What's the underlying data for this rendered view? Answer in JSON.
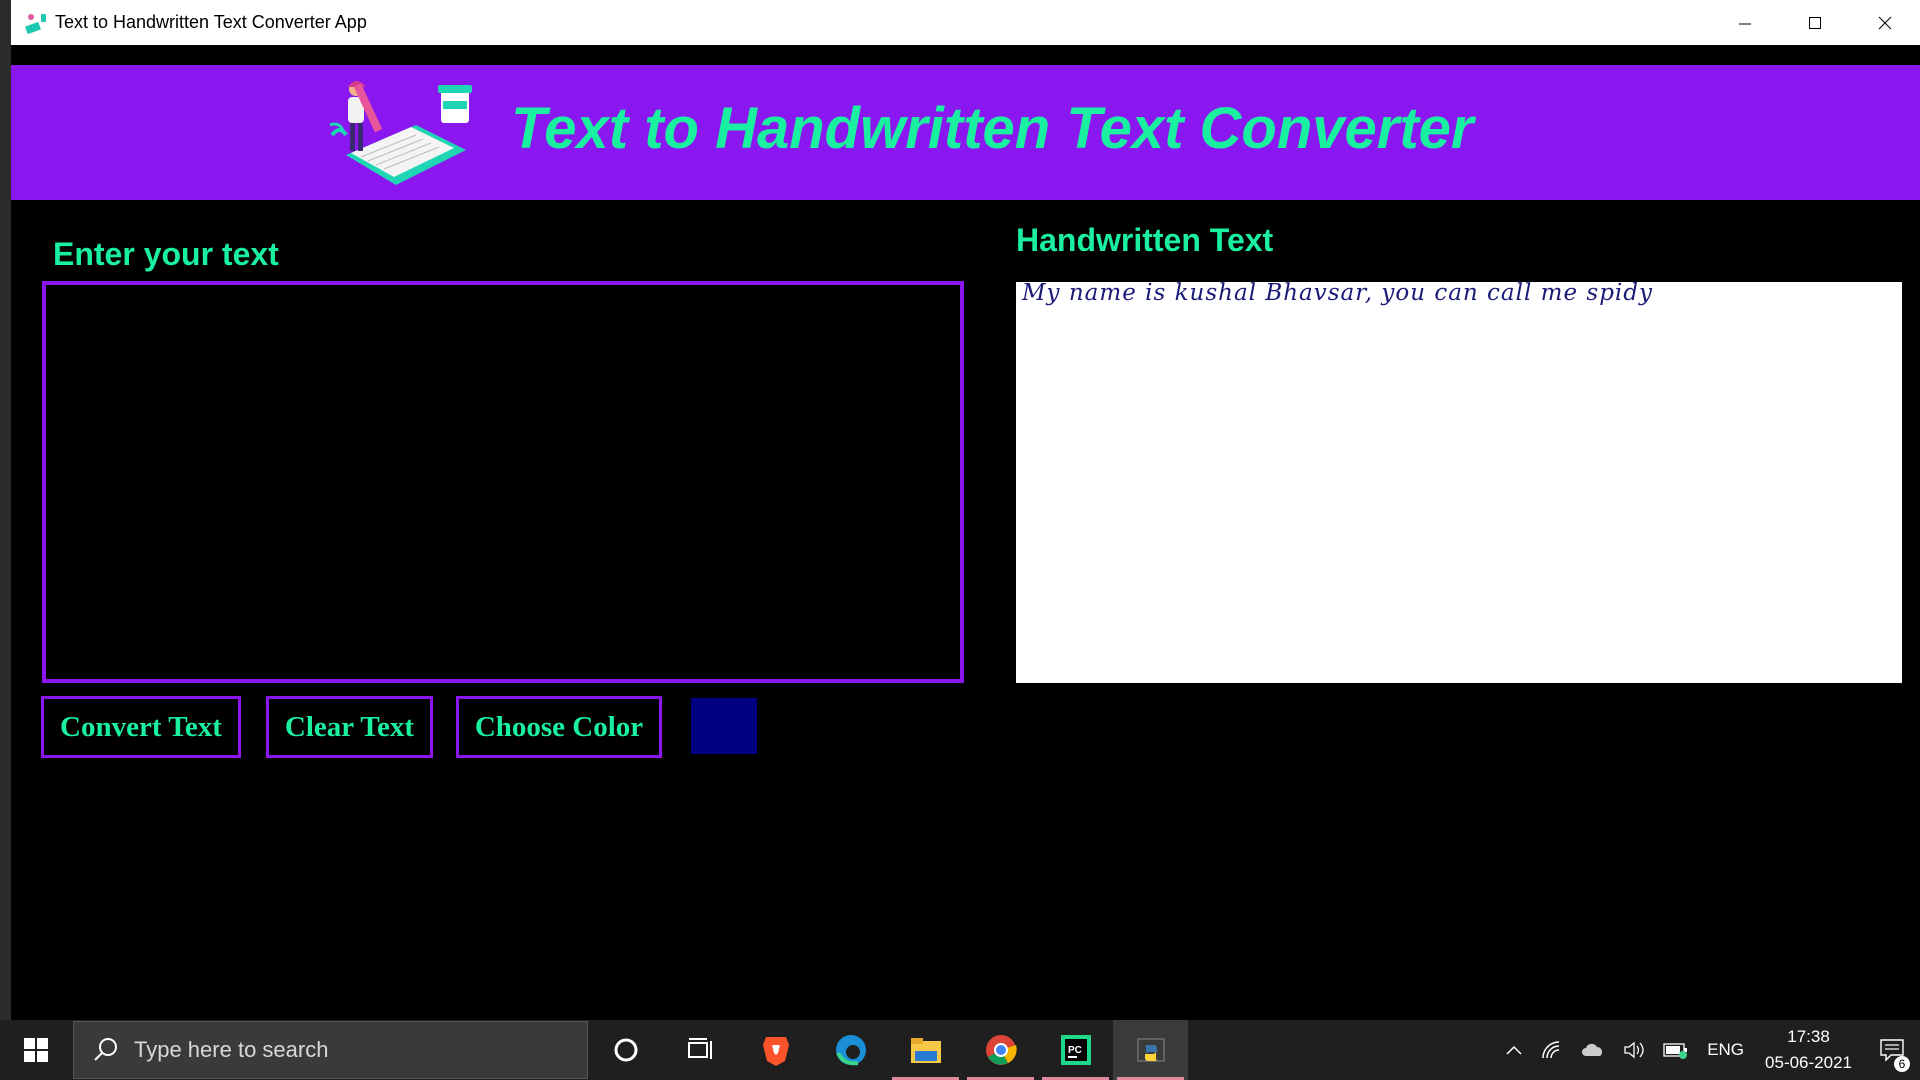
{
  "window": {
    "title": "Text to Handwritten Text Converter App"
  },
  "banner": {
    "title": "Text to Handwritten Text Converter"
  },
  "input": {
    "label": "Enter your text",
    "value": ""
  },
  "output": {
    "label": "Handwritten Text",
    "text": "My name is kushal Bhavsar, you can call me spidy"
  },
  "buttons": {
    "convert": "Convert Text",
    "clear": "Clear Text",
    "choose_color": "Choose Color"
  },
  "colors": {
    "accent": "#8a16f0",
    "text_green": "#19f0a0",
    "selected_color": "#000080"
  },
  "taskbar": {
    "search_placeholder": "Type here to search",
    "language": "ENG",
    "time": "17:38",
    "date": "05-06-2021",
    "notification_count": "6",
    "apps": [
      "cortana-icon",
      "task-view-icon",
      "brave-icon",
      "edge-icon",
      "file-explorer-icon",
      "chrome-icon",
      "pycharm-icon",
      "python-icon"
    ]
  }
}
